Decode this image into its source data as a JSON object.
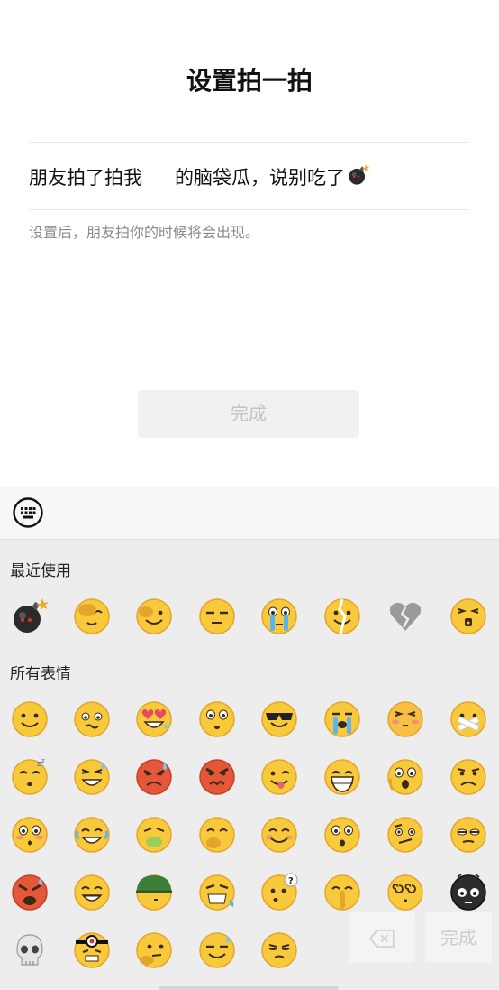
{
  "header": {
    "title": "设置拍一拍"
  },
  "pat": {
    "prefix": "朋友拍了拍我",
    "suffix": "的脑袋瓜，说别吃了",
    "emoji": "bomb"
  },
  "hint": "设置后，朋友拍你的时候将会出现。",
  "done_label": "完成",
  "keyboard": {
    "toggle_icon": "keyboard-icon"
  },
  "sections": {
    "recent": "最近使用",
    "all": "所有表情"
  },
  "recent_emojis": [
    "bomb",
    "facepalm",
    "sly-wink",
    "unamused",
    "teary",
    "crack-face",
    "broken-heart",
    "sealed-mouth"
  ],
  "all_emojis": [
    [
      "smile",
      "worried",
      "heart-eyes",
      "stare",
      "sunglasses",
      "loud-cry",
      "blush-squint",
      "mouth-taped"
    ],
    [
      "sleepy",
      "grin-sweat",
      "angry-red",
      "furious",
      "tongue-wink",
      "big-grin",
      "shocked",
      "sad"
    ],
    [
      "blush-surprised",
      "laugh-cry",
      "nauseous",
      "chuckle",
      "smile-blush",
      "surprised",
      "confused",
      "meh"
    ],
    [
      "rage",
      "grin-squint",
      "army-helmet",
      "tantrum",
      "question",
      "shush",
      "dizzy",
      "dark-angry"
    ],
    [
      "skull",
      "bandaged",
      "thinking",
      "sweat-smile",
      "smug"
    ]
  ],
  "float_buttons": {
    "delete_icon": "backspace-icon",
    "done": "完成"
  },
  "colors": {
    "face": "#f9c93c",
    "face_edge": "#e3a52a",
    "accent_red": "#e45b3c"
  }
}
